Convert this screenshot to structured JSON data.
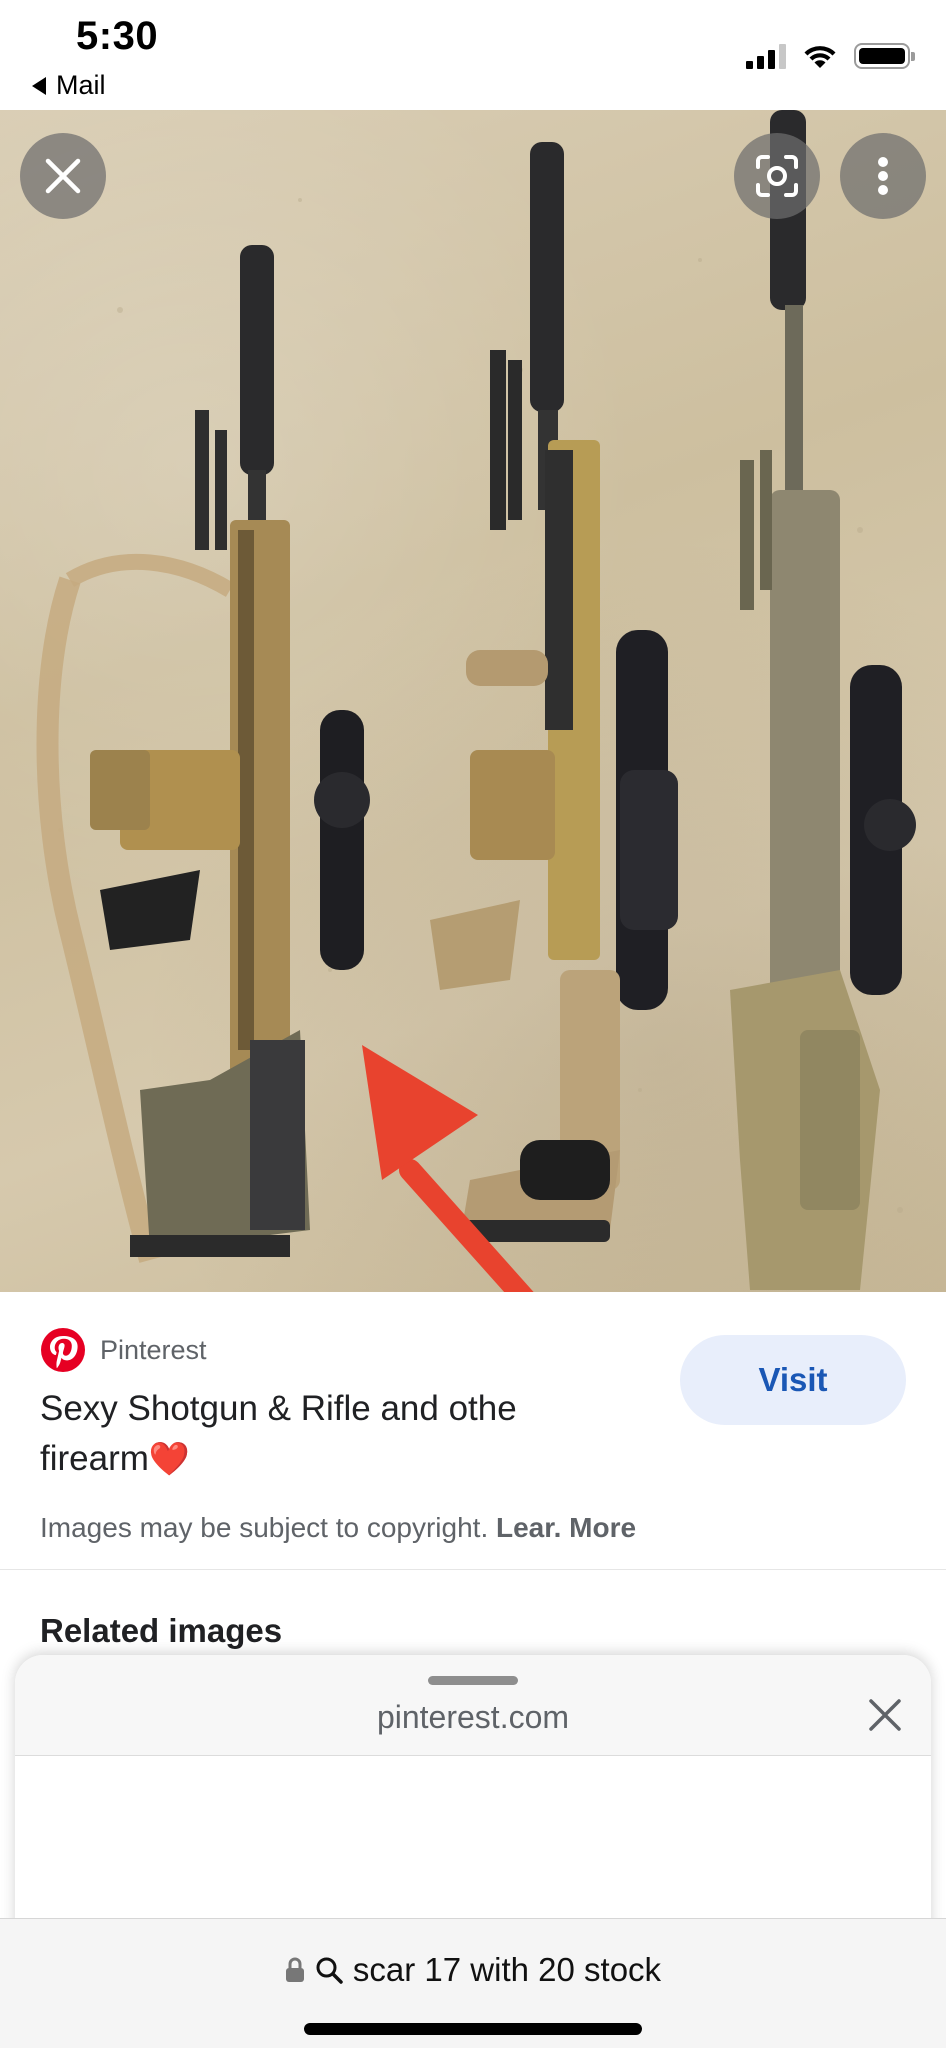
{
  "status_bar": {
    "time": "5:30",
    "back_label": "Mail",
    "icons": [
      "cellular-signal-icon",
      "wifi-icon",
      "battery-icon"
    ]
  },
  "image_viewer": {
    "close_icon": "close-icon",
    "lens_icon": "google-lens-icon",
    "more_icon": "more-vert-icon"
  },
  "result": {
    "source": "Pinterest",
    "source_icon": "pinterest-logo",
    "title_line1": "Sexy Shotgun & Rifle and othe",
    "title_line2": "firearm",
    "title_emoji": "❤️",
    "visit_label": "Visit",
    "copyright_prefix": "Images may be subject to copyright. ",
    "learn_more": "Lear. More"
  },
  "related": {
    "heading": "Related images"
  },
  "sheet": {
    "domain": "pinterest.com"
  },
  "address_bar": {
    "query": "scar 17 with 20 stock"
  },
  "colors": {
    "visit_bg": "#e8eefb",
    "visit_text": "#1a57b5",
    "pinterest_red": "#e60023",
    "annotation_arrow": "#e8432e"
  }
}
